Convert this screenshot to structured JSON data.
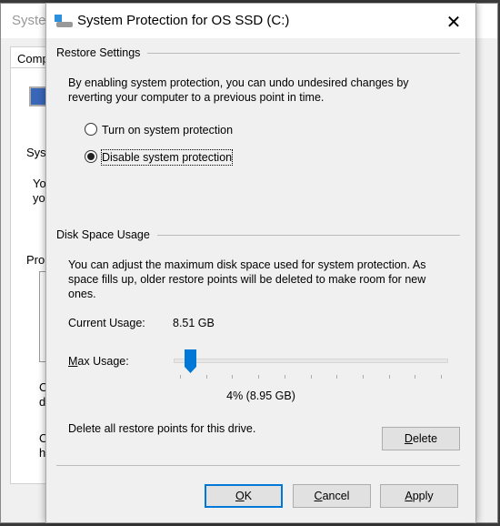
{
  "background_window": {
    "title": "Syster",
    "tab": "Comp",
    "fragments": [
      "Sys",
      "Yo",
      "yo",
      "Pro",
      "C",
      "d",
      "C",
      "h"
    ]
  },
  "dialog": {
    "title": "System Protection for OS SSD (C:)",
    "icon": "drive-icon",
    "close_icon": "close-icon",
    "restore_settings": {
      "heading": "Restore Settings",
      "description_line1": "By enabling system protection, you can undo undesired changes by",
      "description_line2": "reverting your computer to a previous point in time.",
      "options": [
        {
          "label": "Turn on system protection",
          "selected": false
        },
        {
          "label": "Disable system protection",
          "selected": true
        }
      ]
    },
    "disk_space": {
      "heading": "Disk Space Usage",
      "description_line1": "You can adjust the maximum disk space used for system protection. As",
      "description_line2": "space fills up, older restore points will be deleted to make room for new",
      "description_line3": "ones.",
      "current_usage_label": "Current Usage:",
      "current_usage_value": "8.51 GB",
      "max_usage_label_underlined": "M",
      "max_usage_label_rest": "ax Usage:",
      "slider_percent": 4,
      "slider_value_text": "4% (8.95 GB)",
      "delete_text": "Delete all restore points for this drive.",
      "delete_button": {
        "u": "D",
        "rest": "elete"
      }
    },
    "buttons": {
      "ok": {
        "u": "O",
        "rest": "K"
      },
      "cancel": {
        "u": "C",
        "rest": "ancel"
      },
      "apply": {
        "u": "A",
        "rest": "pply"
      }
    },
    "accent_color": "#0078d7"
  }
}
